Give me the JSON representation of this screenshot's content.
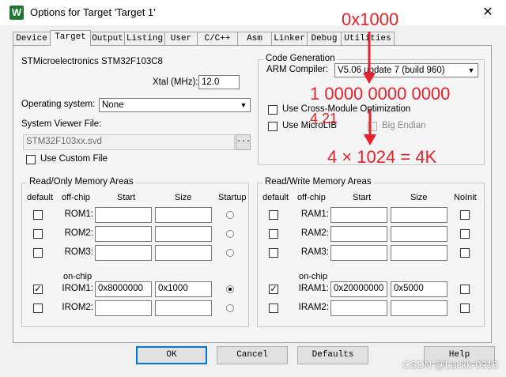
{
  "window": {
    "title": "Options for Target 'Target 1'",
    "app_icon_letter": "W",
    "close_glyph": "✕"
  },
  "tabs": [
    "Device",
    "Target",
    "Output",
    "Listing",
    "User",
    "C/C++",
    "Asm",
    "Linker",
    "Debug",
    "Utilities"
  ],
  "active_tab": "Target",
  "device": "STMicroelectronics STM32F103C8",
  "xtal": {
    "label": "Xtal (MHz):",
    "value": "12.0"
  },
  "os": {
    "label": "Operating system:",
    "value": "None"
  },
  "svd": {
    "label": "System Viewer File:",
    "value": "STM32F103xx.svd",
    "browse": "..."
  },
  "custom_file": {
    "label": "Use Custom File",
    "checked": false
  },
  "code_gen": {
    "title": "Code Generation",
    "compiler_label": "ARM Compiler:",
    "compiler_value": "V5.06 update 7 (build 960)",
    "cross_module": {
      "label": "Use Cross-Module Optimization",
      "checked": false
    },
    "microlib": {
      "label": "Use MicroLIB",
      "checked": false
    },
    "big_endian": {
      "label": "Big Endian",
      "checked": false
    }
  },
  "rom": {
    "title": "Read/Only Memory Areas",
    "headers": {
      "default": "default",
      "offchip": "off-chip",
      "start": "Start",
      "size": "Size",
      "extra": "Startup"
    },
    "onchip_label": "on-chip",
    "rows": [
      {
        "label": "ROM1:",
        "start": "",
        "size": "",
        "default": false,
        "flag": false
      },
      {
        "label": "ROM2:",
        "start": "",
        "size": "",
        "default": false,
        "flag": false
      },
      {
        "label": "ROM3:",
        "start": "",
        "size": "",
        "default": false,
        "flag": false
      },
      {
        "label": "IROM1:",
        "start": "0x8000000",
        "size": "0x1000",
        "default": true,
        "flag": true
      },
      {
        "label": "IROM2:",
        "start": "",
        "size": "",
        "default": false,
        "flag": false
      }
    ]
  },
  "ram": {
    "title": "Read/Write Memory Areas",
    "headers": {
      "default": "default",
      "offchip": "off-chip",
      "start": "Start",
      "size": "Size",
      "extra": "NoInit"
    },
    "onchip_label": "on-chip",
    "rows": [
      {
        "label": "RAM1:",
        "start": "",
        "size": "",
        "default": false,
        "flag": false
      },
      {
        "label": "RAM2:",
        "start": "",
        "size": "",
        "default": false,
        "flag": false
      },
      {
        "label": "RAM3:",
        "start": "",
        "size": "",
        "default": false,
        "flag": false
      },
      {
        "label": "IRAM1:",
        "start": "0x20000000",
        "size": "0x5000",
        "default": true,
        "flag": false
      },
      {
        "label": "IRAM2:",
        "start": "",
        "size": "",
        "default": false,
        "flag": false
      }
    ]
  },
  "buttons": {
    "ok": "OK",
    "cancel": "Cancel",
    "defaults": "Defaults",
    "help": "Help"
  },
  "annotations": {
    "hex": "0x1000",
    "binary": "1 0000 0000 0000",
    "exp": "4 21",
    "calc": "4 × 1024 = 4K"
  },
  "watermark": "CSDN @Luckk-0915",
  "colors": {
    "annotation": "#e8202a",
    "default_button_border": "#0078d7"
  }
}
